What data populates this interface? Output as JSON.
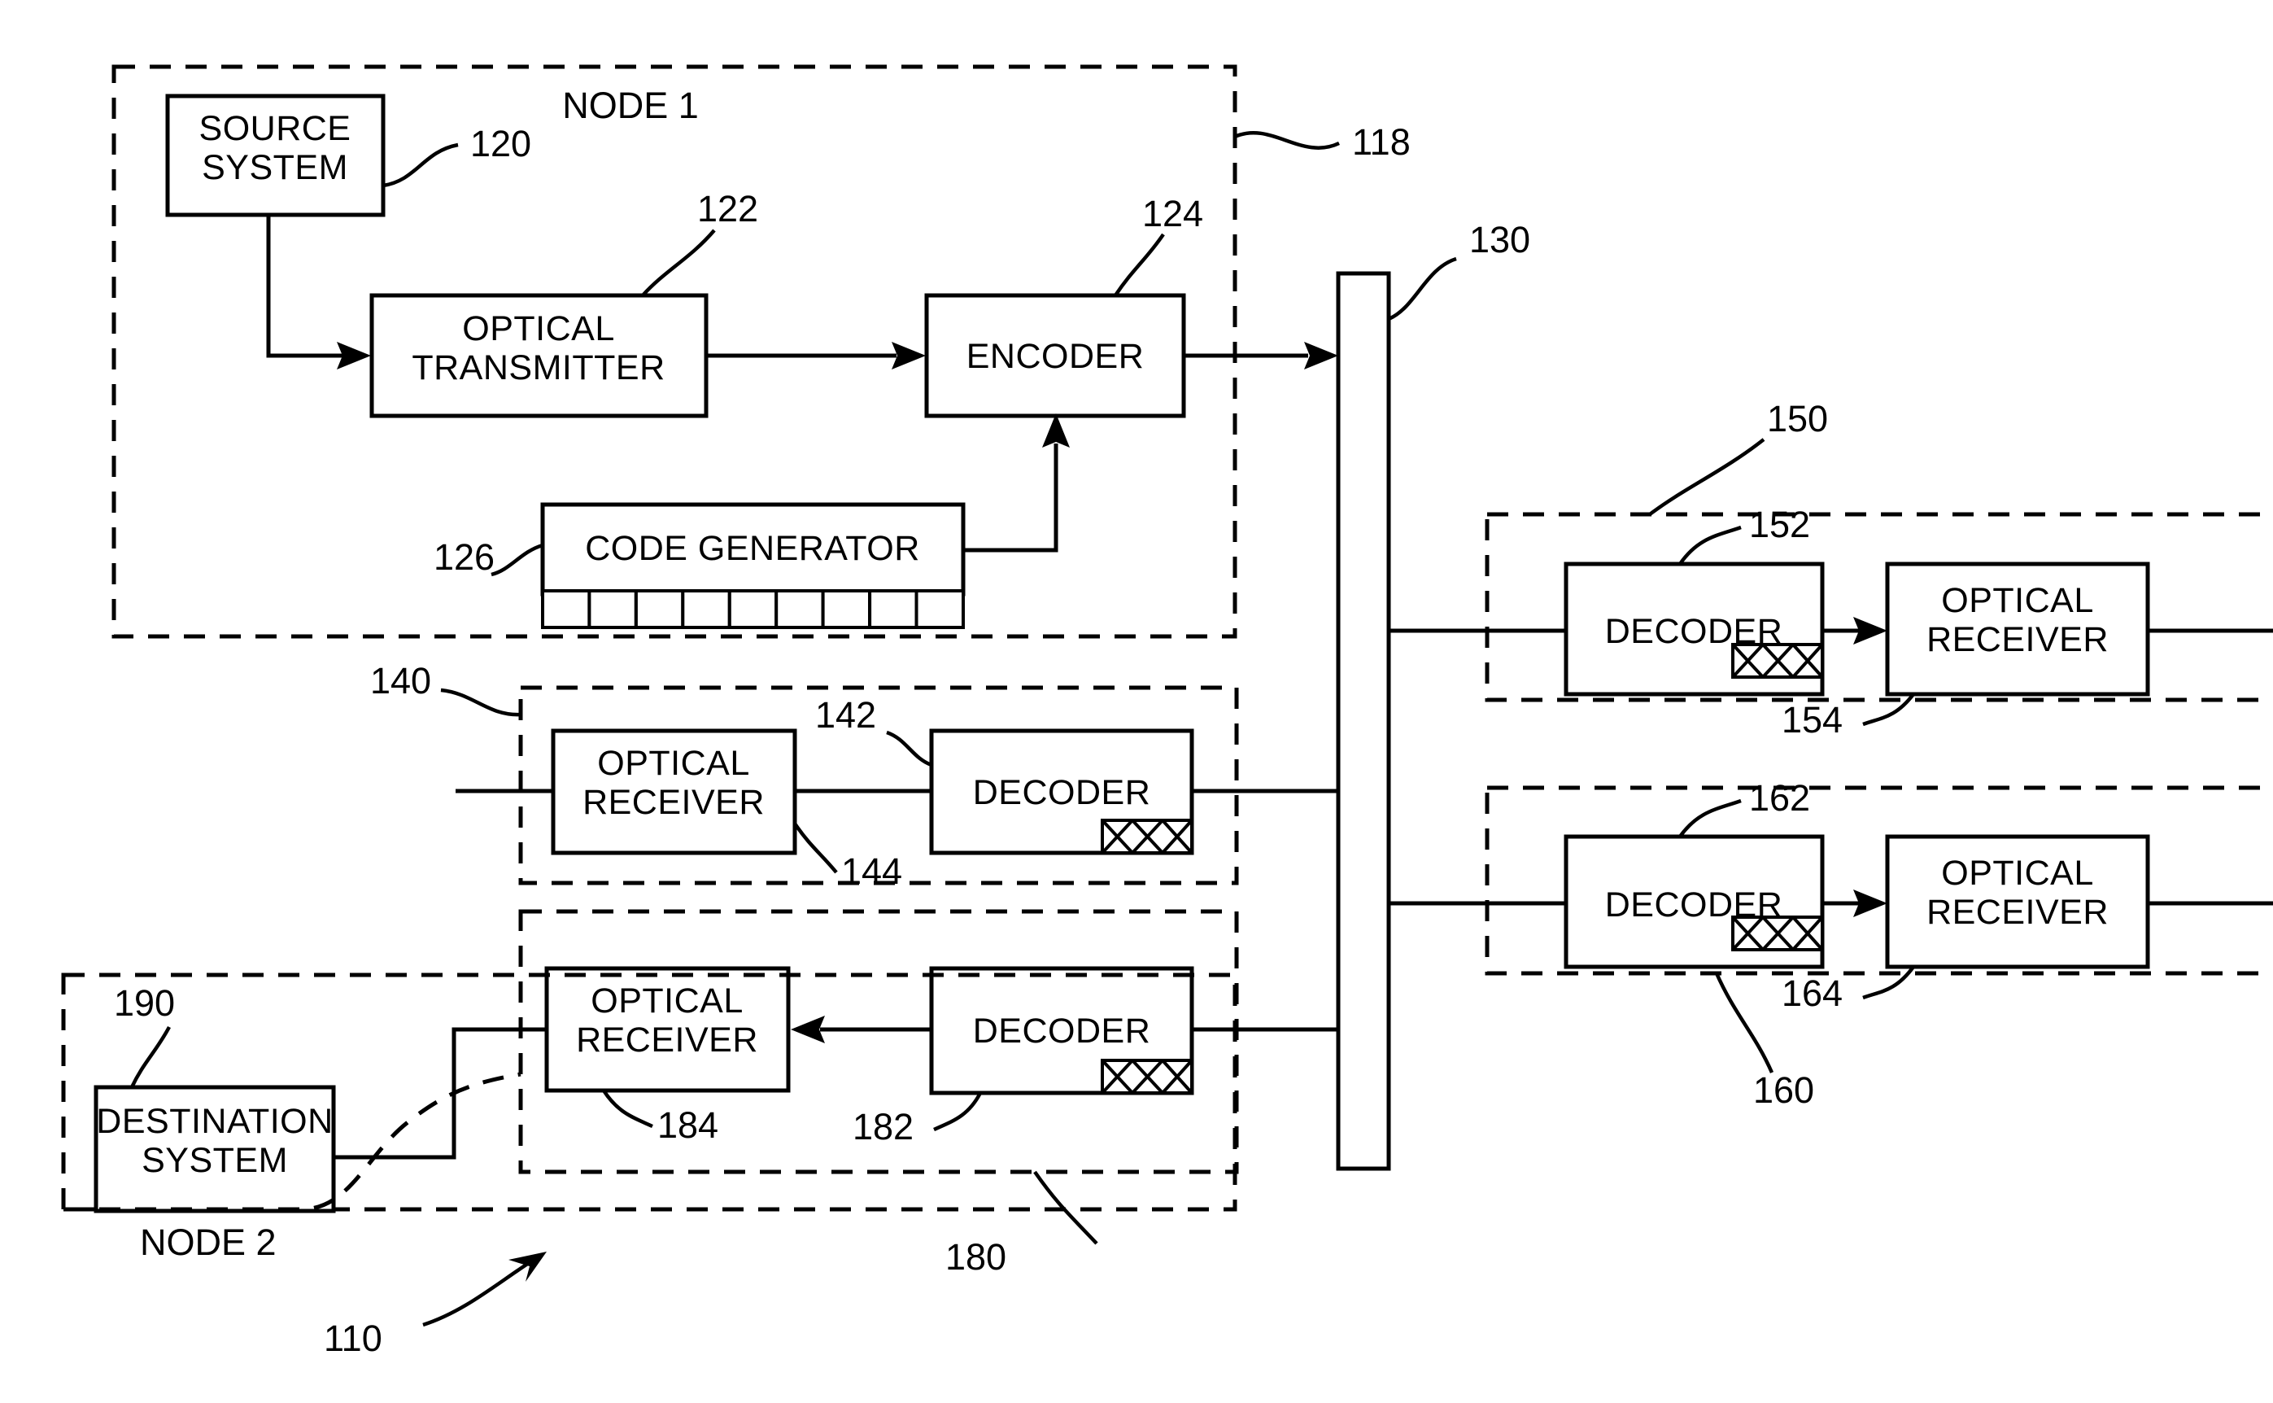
{
  "figure": {
    "type": "patent-block-diagram",
    "overall_ref": "110"
  },
  "node1": {
    "title": "NODE 1",
    "border_ref": "118",
    "blocks": [
      {
        "id": "source_system",
        "label": "SOURCE SYSTEM",
        "ref": "120"
      },
      {
        "id": "optical_transmitter",
        "label": "OPTICAL TRANSMITTER",
        "ref": "122"
      },
      {
        "id": "encoder",
        "label": "ENCODER",
        "ref": "124"
      },
      {
        "id": "code_generator",
        "label": "CODE GENERATOR",
        "ref": "126",
        "cells": 9
      }
    ]
  },
  "medium": {
    "label": "",
    "ref": "130",
    "name": "optical-transmission-medium"
  },
  "branch140": {
    "ref": "140",
    "blocks": [
      {
        "id": "optical_receiver_144",
        "label": "OPTICAL RECEIVER",
        "ref": "144"
      },
      {
        "id": "decoder_142",
        "label": "DECODER",
        "ref": "142",
        "hatch": "XXX"
      }
    ]
  },
  "branch150": {
    "ref": "150",
    "blocks": [
      {
        "id": "decoder_152",
        "label": "DECODER",
        "ref": "152",
        "hatch": "XXX"
      },
      {
        "id": "optical_receiver_154",
        "label": "OPTICAL RECEIVER",
        "ref": "154"
      }
    ]
  },
  "branch160": {
    "ref": "160",
    "blocks": [
      {
        "id": "decoder_162",
        "label": "DECODER",
        "ref": "162",
        "hatch": "XXX"
      },
      {
        "id": "optical_receiver_164",
        "label": "OPTICAL RECEIVER",
        "ref": "164"
      }
    ]
  },
  "branch180": {
    "ref": "180",
    "blocks": [
      {
        "id": "decoder_182",
        "label": "DECODER",
        "ref": "182",
        "hatch": "XXX"
      },
      {
        "id": "optical_receiver_184",
        "label": "OPTICAL RECEIVER",
        "ref": "184"
      }
    ]
  },
  "node2": {
    "title": "NODE 2",
    "blocks": [
      {
        "id": "destination_system",
        "label": "DESTINATION SYSTEM",
        "ref": "190"
      }
    ]
  },
  "labels": {
    "node1_title": "NODE 1",
    "node2_title": "NODE 2",
    "source_system_l1": "SOURCE",
    "source_system_l2": "SYSTEM",
    "optical_transmitter_l1": "OPTICAL",
    "optical_transmitter_l2": "TRANSMITTER",
    "encoder": "ENCODER",
    "code_generator": "CODE GENERATOR",
    "optical_receiver_l1": "OPTICAL",
    "optical_receiver_l2": "RECEIVER",
    "decoder": "DECODER",
    "destination_system_l1": "DESTINATION",
    "destination_system_l2": "SYSTEM",
    "hatch_text": "XXX"
  },
  "refs": {
    "r110": "110",
    "r118": "118",
    "r120": "120",
    "r122": "122",
    "r124": "124",
    "r126": "126",
    "r130": "130",
    "r140": "140",
    "r142": "142",
    "r144": "144",
    "r150": "150",
    "r152": "152",
    "r154": "154",
    "r160": "160",
    "r162": "162",
    "r164": "164",
    "r180": "180",
    "r182": "182",
    "r184": "184",
    "r190": "190"
  },
  "colors": {
    "ink": "#000000",
    "paper": "#ffffff"
  }
}
